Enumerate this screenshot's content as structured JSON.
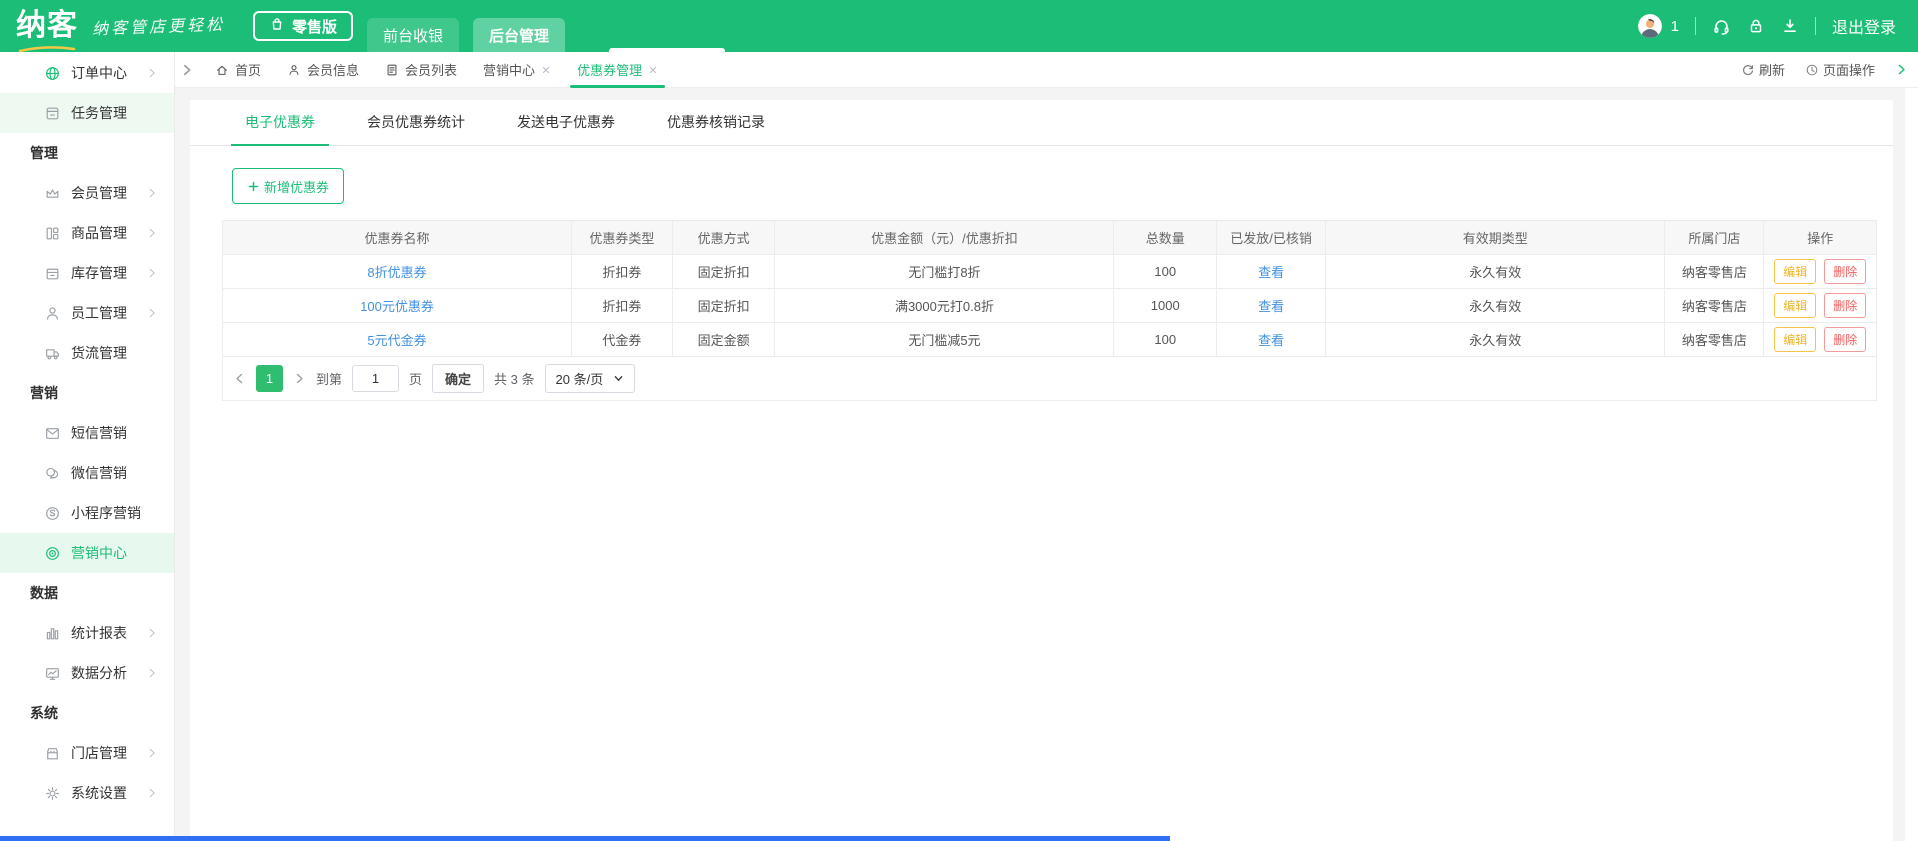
{
  "colors": {
    "primary": "#1CBE77",
    "logo_accent": "#F6C743",
    "link": "#4291E2",
    "edit": "#F0B429",
    "delete": "#F15E5E",
    "active_bg": "#E7F8EF",
    "page_btn": "#2FBE70"
  },
  "header": {
    "logo": "纳客",
    "tagline": "纳客管店更轻松",
    "edition_button": "零售版",
    "nav": [
      {
        "label": "前台收银",
        "active": false
      },
      {
        "label": "后台管理",
        "active": true
      }
    ],
    "user_count": "1",
    "logout": "退出登录",
    "icons": {
      "avatar": "avatar-icon",
      "service": "headset-icon",
      "lock": "lock-icon",
      "download": "download-icon",
      "edition": "bag-icon"
    }
  },
  "tabbar": {
    "tabs": [
      {
        "label": "首页",
        "icon": "home-icon",
        "closable": false,
        "active": false
      },
      {
        "label": "会员信息",
        "icon": "user-icon",
        "closable": false,
        "active": false
      },
      {
        "label": "会员列表",
        "icon": "list-icon",
        "closable": false,
        "active": false
      },
      {
        "label": "营销中心",
        "icon": "",
        "closable": true,
        "active": false
      },
      {
        "label": "优惠券管理",
        "icon": "",
        "closable": true,
        "active": true
      }
    ],
    "refresh": "刷新",
    "page_actions": "页面操作"
  },
  "sidebar": {
    "items": [
      {
        "type": "item",
        "label": "订单中心",
        "icon": "globe-icon",
        "icon_green": true,
        "chevron": true
      },
      {
        "type": "item",
        "label": "任务管理",
        "icon": "task-icon",
        "highlight": true
      },
      {
        "type": "section",
        "label": "管理"
      },
      {
        "type": "item",
        "label": "会员管理",
        "icon": "crown-icon",
        "chevron": true
      },
      {
        "type": "item",
        "label": "商品管理",
        "icon": "goods-icon",
        "chevron": true
      },
      {
        "type": "item",
        "label": "库存管理",
        "icon": "inventory-icon",
        "chevron": true
      },
      {
        "type": "item",
        "label": "员工管理",
        "icon": "staff-icon",
        "chevron": true
      },
      {
        "type": "item",
        "label": "货流管理",
        "icon": "truck-icon"
      },
      {
        "type": "section",
        "label": "营销"
      },
      {
        "type": "item",
        "label": "短信营销",
        "icon": "sms-icon"
      },
      {
        "type": "item",
        "label": "微信营销",
        "icon": "wechat-icon"
      },
      {
        "type": "item",
        "label": "小程序营销",
        "icon": "miniprogram-icon"
      },
      {
        "type": "item",
        "label": "营销中心",
        "icon": "target-icon",
        "active": true
      },
      {
        "type": "section",
        "label": "数据"
      },
      {
        "type": "item",
        "label": "统计报表",
        "icon": "chart-icon",
        "chevron": true
      },
      {
        "type": "item",
        "label": "数据分析",
        "icon": "monitor-icon",
        "chevron": true
      },
      {
        "type": "section",
        "label": "系统"
      },
      {
        "type": "item",
        "label": "门店管理",
        "icon": "store-icon",
        "chevron": true
      },
      {
        "type": "item",
        "label": "系统设置",
        "icon": "gear-icon",
        "chevron": true
      }
    ]
  },
  "main": {
    "tabs": [
      {
        "label": "电子优惠券",
        "active": true
      },
      {
        "label": "会员优惠券统计",
        "active": false
      },
      {
        "label": "发送电子优惠券",
        "active": false
      },
      {
        "label": "优惠券核销记录",
        "active": false
      }
    ],
    "add_label": "新增优惠券",
    "table": {
      "columns": [
        "优惠券名称",
        "优惠券类型",
        "优惠方式",
        "优惠金额（元）/优惠折扣",
        "总数量",
        "已发放/已核销",
        "有效期类型",
        "所属门店",
        "操作"
      ],
      "col_widths_pct": [
        21.1,
        6.1,
        6.2,
        20.5,
        6.2,
        6.6,
        20.5,
        6.0,
        6.8
      ],
      "rows": [
        {
          "name": "8折优惠券",
          "type": "折扣券",
          "method": "固定折扣",
          "amount": "无门槛打8折",
          "total": "100",
          "issued": "查看",
          "validity": "永久有效",
          "store": "纳客零售店"
        },
        {
          "name": "100元优惠券",
          "type": "折扣券",
          "method": "固定折扣",
          "amount": "满3000元打0.8折",
          "total": "1000",
          "issued": "查看",
          "validity": "永久有效",
          "store": "纳客零售店"
        },
        {
          "name": "5元代金券",
          "type": "代金券",
          "method": "固定金额",
          "amount": "无门槛减5元",
          "total": "100",
          "issued": "查看",
          "validity": "永久有效",
          "store": "纳客零售店"
        }
      ],
      "actions": {
        "edit": "编辑",
        "delete": "删除"
      }
    },
    "pagination": {
      "current_page": "1",
      "goto_prefix": "到第",
      "goto_value": "1",
      "goto_suffix": "页",
      "confirm": "确定",
      "total": "共 3 条",
      "page_size": "20 条/页"
    }
  }
}
